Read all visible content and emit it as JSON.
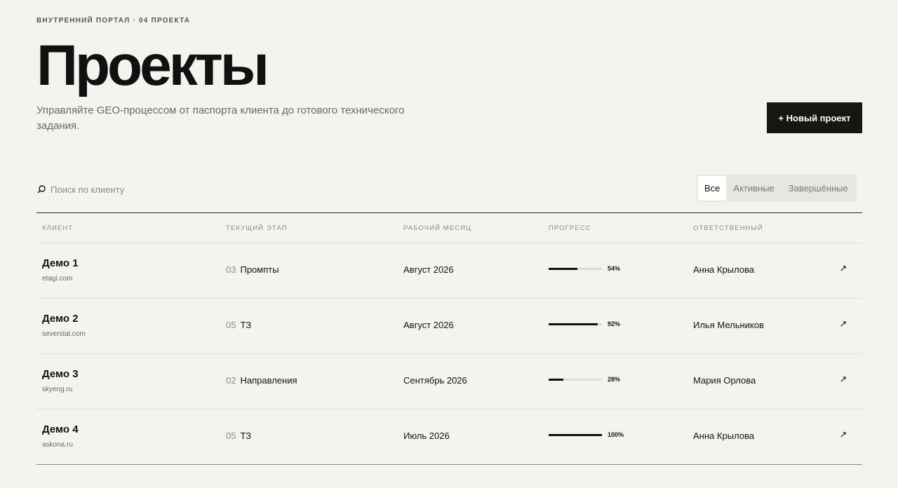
{
  "header": {
    "eyebrow": "ВНУТРЕННИЙ ПОРТАЛ · 04 ПРОЕКТА",
    "title": "Проекты",
    "subtitle": "Управляйте GEO-процессом от паспорта клиента до готового технического задания.",
    "new_button": "+ Новый проект"
  },
  "search": {
    "placeholder": "Поиск по клиенту",
    "value": ""
  },
  "filters": [
    {
      "label": "Все",
      "active": true
    },
    {
      "label": "Активные",
      "active": false
    },
    {
      "label": "Завершённые",
      "active": false
    }
  ],
  "table": {
    "columns": [
      "КЛИЕНТ",
      "ТЕКУЩИЙ ЭТАП",
      "РАБОЧИЙ МЕСЯЦ",
      "ПРОГРЕСС",
      "ОТВЕТСТВЕННЫЙ"
    ],
    "rows": [
      {
        "client": "Демо 1",
        "domain": "etagi.com",
        "stage_num": "03",
        "stage": "Промпты",
        "month": "Август 2026",
        "progress": 54,
        "progress_label": "54%",
        "owner": "Анна Крылова",
        "arrow": "↗"
      },
      {
        "client": "Демо 2",
        "domain": "severstal.com",
        "stage_num": "05",
        "stage": "ТЗ",
        "month": "Август 2026",
        "progress": 92,
        "progress_label": "92%",
        "owner": "Илья Мельников",
        "arrow": "↗"
      },
      {
        "client": "Демо 3",
        "domain": "skyeng.ru",
        "stage_num": "02",
        "stage": "Направления",
        "month": "Сентябрь 2026",
        "progress": 28,
        "progress_label": "28%",
        "owner": "Мария Орлова",
        "arrow": "↗"
      },
      {
        "client": "Демо 4",
        "domain": "askona.ru",
        "stage_num": "05",
        "stage": "ТЗ",
        "month": "Июль 2026",
        "progress": 100,
        "progress_label": "100%",
        "owner": "Анна Крылова",
        "arrow": "↗"
      }
    ]
  },
  "colors": {
    "background": "#f4f4ef",
    "accent": "#161612",
    "muted": "#888888"
  },
  "icons": {
    "search": "search-icon",
    "open": "arrow-up-right-icon"
  }
}
